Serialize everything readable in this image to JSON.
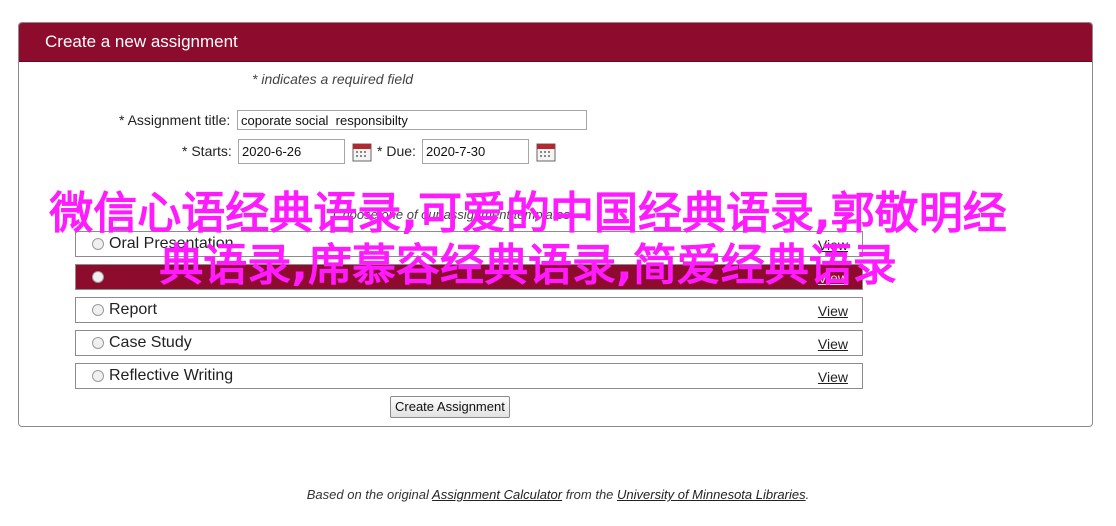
{
  "header": {
    "title": "Create a new assignment"
  },
  "form": {
    "required_note": "* indicates a required field",
    "title_label": "* Assignment title:",
    "title_value": "coporate social  responsibilty",
    "starts_label": "* Starts:",
    "starts_value": "2020-6-26",
    "due_label": "* Due:",
    "due_value": "2020-7-30",
    "templates_label": "Choose one of our assignment templates",
    "templates": [
      {
        "name": "Oral Presentation",
        "view": "View",
        "selected": false
      },
      {
        "name": "",
        "view": "View",
        "selected": true
      },
      {
        "name": "Report",
        "view": "View",
        "selected": false
      },
      {
        "name": "Case Study",
        "view": "View",
        "selected": false
      },
      {
        "name": "Reflective Writing",
        "view": "View",
        "selected": false
      }
    ],
    "create_button": "Create Assignment"
  },
  "footer": {
    "prefix": "Based on the original ",
    "link1": "Assignment Calculator",
    "middle": " from the ",
    "link2": "University of Minnesota Libraries",
    "suffix": "."
  },
  "overlay_text": "微信心语经典语录,可爱的中国经典语录,郭敬明经典语录,席慕容经典语录,简爱经典语录",
  "colors": {
    "header": "#8d0b2c",
    "overlay": "#ff1aff"
  }
}
